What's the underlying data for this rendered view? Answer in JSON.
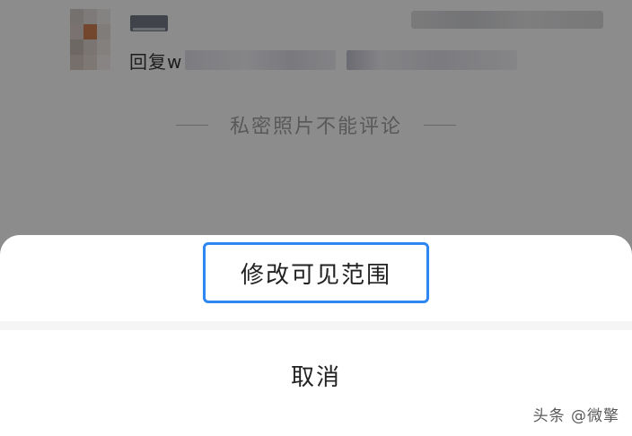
{
  "background": {
    "reply_prefix": "回复w",
    "notice_text": "私密照片不能评论"
  },
  "action_sheet": {
    "edit_visibility_label": "修改可见范围",
    "cancel_label": "取消",
    "highlight_color": "#2e86f2"
  },
  "watermark": {
    "text": "头条 @微擎"
  }
}
